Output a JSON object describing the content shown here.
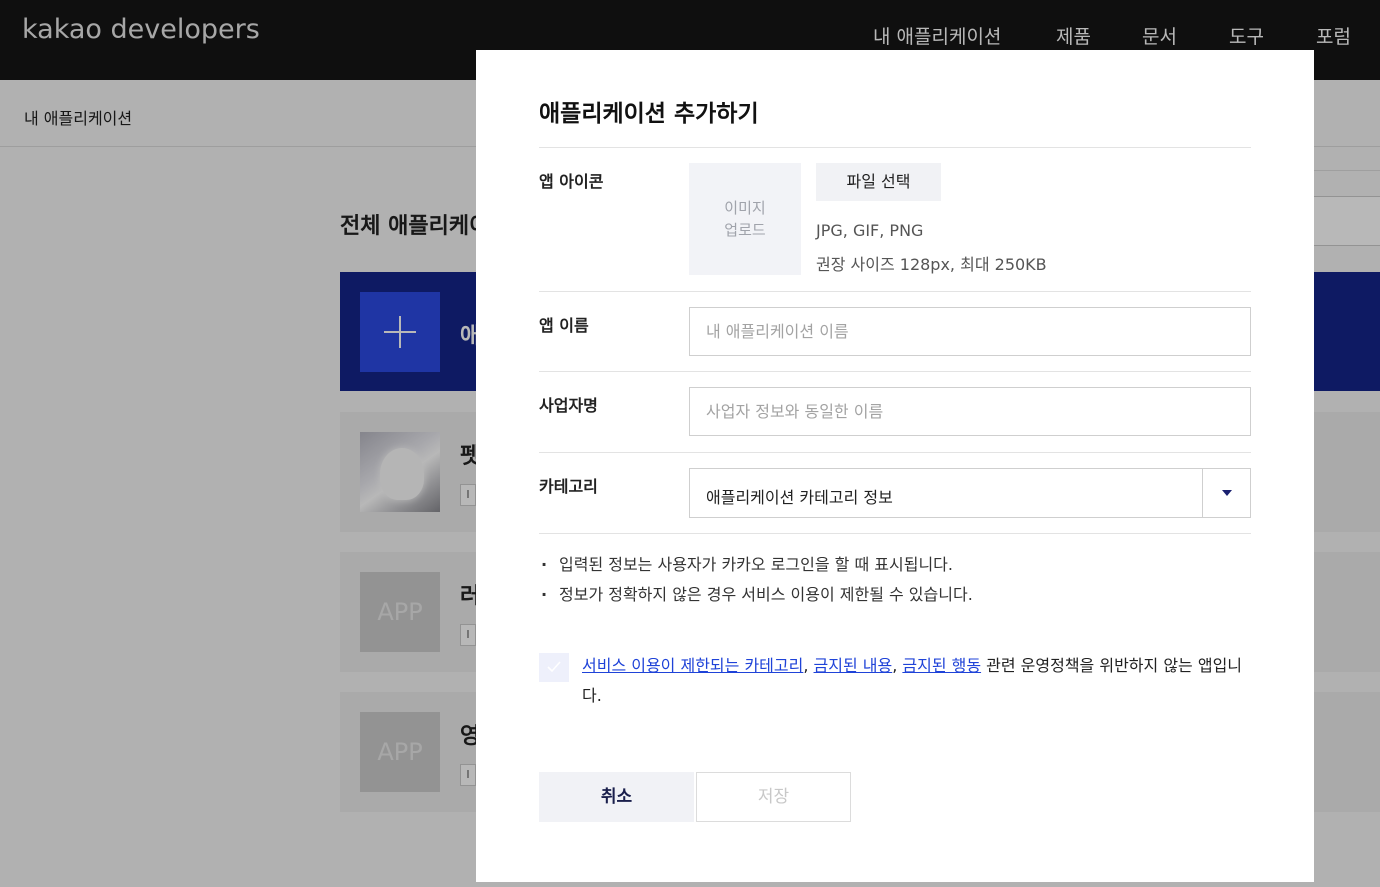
{
  "header": {
    "logo": "kakao developers",
    "nav": [
      "내 애플리케이션",
      "제품",
      "문서",
      "도구",
      "포럼"
    ]
  },
  "breadcrumb": "내 애플리케이션",
  "background": {
    "heading": "전체 애플리케이",
    "add_card_label": "애",
    "apps": [
      {
        "name": "펫",
        "thumb": "",
        "tag": "I"
      },
      {
        "name": "러",
        "thumb": "APP",
        "tag": "I"
      },
      {
        "name": "영",
        "thumb": "APP",
        "tag": "I"
      }
    ]
  },
  "modal": {
    "title": "애플리케이션 추가하기",
    "icon": {
      "label": "앱 아이콘",
      "upload_line1": "이미지",
      "upload_line2": "업로드",
      "file_button": "파일 선택",
      "formats": "JPG, GIF, PNG",
      "size_hint": "권장 사이즈 128px, 최대 250KB"
    },
    "app_name": {
      "label": "앱 이름",
      "placeholder": "내 애플리케이션 이름",
      "value": ""
    },
    "business_name": {
      "label": "사업자명",
      "placeholder": "사업자 정보와 동일한 이름",
      "value": ""
    },
    "category": {
      "label": "카테고리",
      "selected": "애플리케이션 카테고리 정보",
      "icon": "chevron-down-icon"
    },
    "notes": [
      "입력된 정보는 사용자가 카카오 로그인을 할 때 표시됩니다.",
      "정보가 정확하지 않은 경우 서비스 이용이 제한될 수 있습니다."
    ],
    "agreement": {
      "checked": false,
      "link1": "서비스 이용이 제한되는 카테고리",
      "sep1": ", ",
      "link2": "금지된 내용",
      "sep2": ", ",
      "link3": "금지된 행동",
      "rest": " 관련 운영정책을 위반하지 않는 앱입니다."
    },
    "buttons": {
      "cancel": "취소",
      "save": "저장"
    }
  },
  "colors": {
    "header_bg": "#161616",
    "primary_dark": "#142489",
    "primary": "#2b4ae4",
    "link": "#1f43d8"
  }
}
